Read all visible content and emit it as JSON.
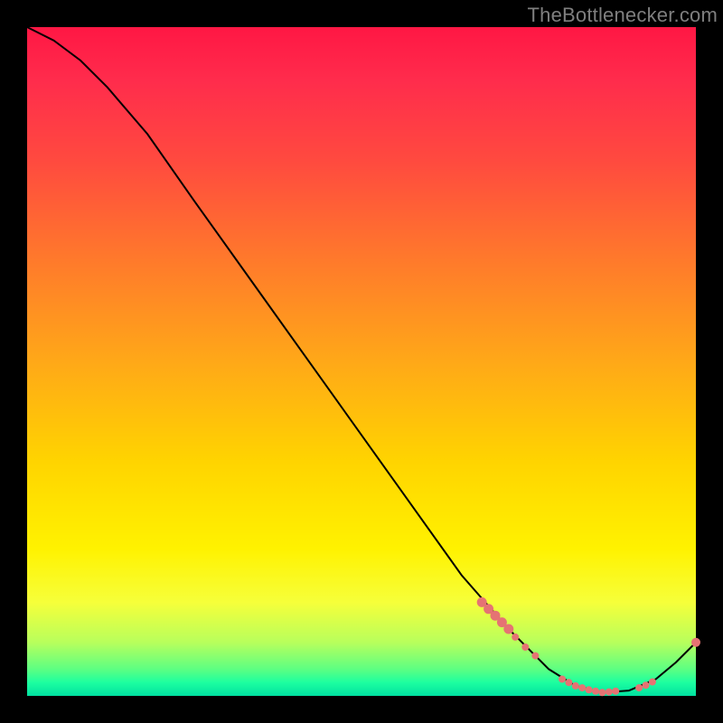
{
  "attribution": "TheBottlenecker.com",
  "colors": {
    "gradient_top": "#ff1744",
    "gradient_mid": "#ffd400",
    "gradient_bottom": "#00e0a0",
    "curve": "#000000",
    "marker": "#e57373",
    "background": "#000000",
    "attribution_text": "#7f7f7f"
  },
  "chart_data": {
    "type": "line",
    "title": "",
    "xlabel": "",
    "ylabel": "",
    "xlim": [
      0,
      100
    ],
    "ylim": [
      0,
      100
    ],
    "grid": false,
    "legend": false,
    "series": [
      {
        "name": "curve",
        "points": [
          {
            "x": 0,
            "y": 100
          },
          {
            "x": 4,
            "y": 98
          },
          {
            "x": 8,
            "y": 95
          },
          {
            "x": 12,
            "y": 91
          },
          {
            "x": 18,
            "y": 84
          },
          {
            "x": 25,
            "y": 74
          },
          {
            "x": 35,
            "y": 60
          },
          {
            "x": 45,
            "y": 46
          },
          {
            "x": 55,
            "y": 32
          },
          {
            "x": 65,
            "y": 18
          },
          {
            "x": 72,
            "y": 10
          },
          {
            "x": 78,
            "y": 4
          },
          {
            "x": 82,
            "y": 1.5
          },
          {
            "x": 86,
            "y": 0.5
          },
          {
            "x": 90,
            "y": 0.8
          },
          {
            "x": 94,
            "y": 2.5
          },
          {
            "x": 97,
            "y": 5
          },
          {
            "x": 100,
            "y": 8
          }
        ]
      }
    ],
    "markers": [
      {
        "x": 68,
        "y": 14,
        "r": 5.5
      },
      {
        "x": 69,
        "y": 13,
        "r": 5.5
      },
      {
        "x": 70,
        "y": 12,
        "r": 5.5
      },
      {
        "x": 71,
        "y": 11,
        "r": 5.5
      },
      {
        "x": 72,
        "y": 10,
        "r": 5.5
      },
      {
        "x": 73,
        "y": 8.8,
        "r": 4
      },
      {
        "x": 74.5,
        "y": 7.3,
        "r": 4
      },
      {
        "x": 76,
        "y": 6.0,
        "r": 4
      },
      {
        "x": 80,
        "y": 2.5,
        "r": 4
      },
      {
        "x": 81,
        "y": 2.0,
        "r": 4
      },
      {
        "x": 82,
        "y": 1.5,
        "r": 4
      },
      {
        "x": 83,
        "y": 1.2,
        "r": 4
      },
      {
        "x": 84,
        "y": 0.9,
        "r": 4
      },
      {
        "x": 85,
        "y": 0.7,
        "r": 4
      },
      {
        "x": 86,
        "y": 0.5,
        "r": 4
      },
      {
        "x": 87,
        "y": 0.6,
        "r": 4
      },
      {
        "x": 88,
        "y": 0.7,
        "r": 4
      },
      {
        "x": 91.5,
        "y": 1.2,
        "r": 4
      },
      {
        "x": 92.5,
        "y": 1.6,
        "r": 4
      },
      {
        "x": 93.5,
        "y": 2.1,
        "r": 4
      },
      {
        "x": 100,
        "y": 8,
        "r": 5
      }
    ]
  }
}
